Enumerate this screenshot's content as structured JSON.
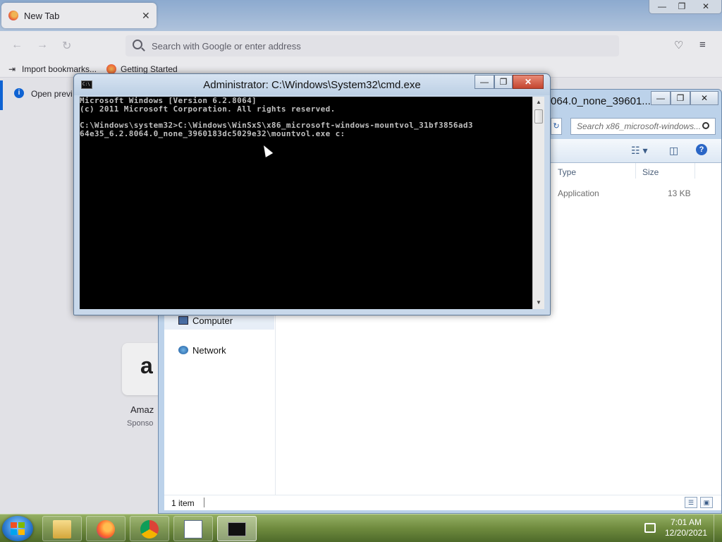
{
  "firefox": {
    "tab_title": "New Tab",
    "tab_close": "✕",
    "search_placeholder": "Search with Google or enter address",
    "bookmarks": [
      "Import bookmarks...",
      "Getting Started"
    ],
    "info_text": "Open previ",
    "tile_name": "Amaz",
    "tile_sponsor": "Sponso",
    "tile_letter": "a",
    "window_controls": [
      "—",
      "❐",
      "✕"
    ]
  },
  "explorer": {
    "title": "064.0_none_39601...",
    "search_placeholder": "Search x86_microsoft-windows...",
    "columns": [
      "Type",
      "Size"
    ],
    "row": {
      "type": "Application",
      "size": "13 KB"
    },
    "nav": [
      "Computer",
      "Network"
    ],
    "status": "1 item",
    "window_controls": [
      "—",
      "❐",
      "✕"
    ]
  },
  "cmd": {
    "title": "Administrator: C:\\Windows\\System32\\cmd.exe",
    "icon_text": "C:\\",
    "lines": [
      "Microsoft Windows [Version 6.2.8064]",
      "(c) 2011 Microsoft Corporation. All rights reserved.",
      "",
      "C:\\Windows\\system32>C:\\Windows\\WinSxS\\x86_microsoft-windows-mountvol_31bf3856ad3",
      "64e35_6.2.8064.0_none_3960183dc5029e32\\mountvol.exe c:"
    ],
    "window_controls": [
      "—",
      "❐",
      "✕"
    ]
  },
  "taskbar": {
    "time": "7:01 AM",
    "date": "12/20/2021",
    "apps": [
      "file-explorer",
      "firefox",
      "chrome",
      "task-list",
      "command-prompt"
    ]
  }
}
